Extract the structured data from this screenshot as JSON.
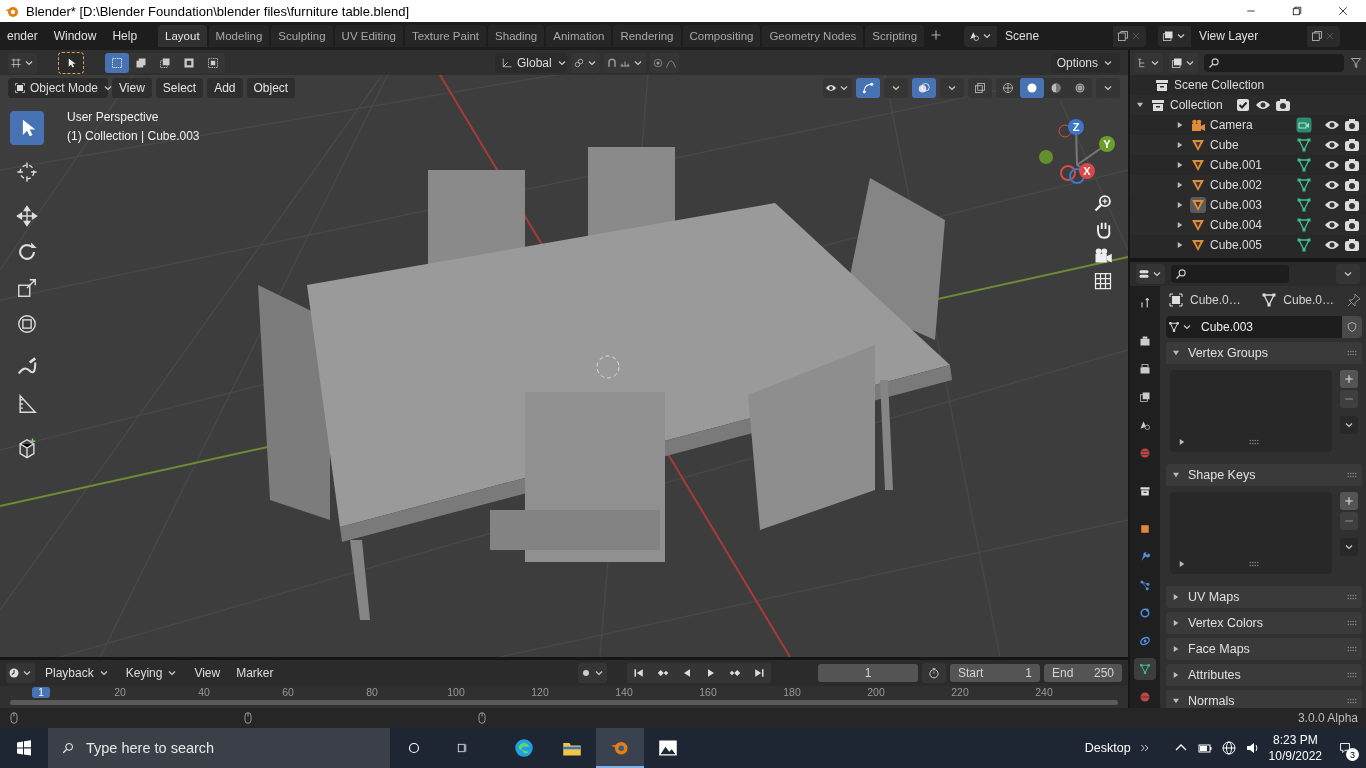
{
  "window": {
    "title": "Blender* [D:\\Blender Foundation\\blender files\\furniture table.blend]"
  },
  "menu": [
    "ender",
    "Window",
    "Help"
  ],
  "workspaces": [
    {
      "label": "Layout",
      "selected": true
    },
    {
      "label": "Modeling",
      "selected": false
    },
    {
      "label": "Sculpting",
      "selected": false
    },
    {
      "label": "UV Editing",
      "selected": false
    },
    {
      "label": "Texture Paint",
      "selected": false
    },
    {
      "label": "Shading",
      "selected": false
    },
    {
      "label": "Animation",
      "selected": false
    },
    {
      "label": "Rendering",
      "selected": false
    },
    {
      "label": "Compositing",
      "selected": false
    },
    {
      "label": "Geometry Nodes",
      "selected": false
    },
    {
      "label": "Scripting",
      "selected": false
    }
  ],
  "scene": "Scene",
  "view_layer": "View Layer",
  "tool_header": {
    "select_modes": [
      {
        "kind": "set",
        "selected": true
      },
      {
        "kind": "extend",
        "selected": false
      },
      {
        "kind": "subtract",
        "selected": false
      },
      {
        "kind": "difference",
        "selected": false
      },
      {
        "kind": "intersect",
        "selected": false
      }
    ],
    "orientation": "Global",
    "options": "Options"
  },
  "viewport_header": {
    "mode": "Object Mode",
    "menus": [
      "View",
      "Select",
      "Add",
      "Object"
    ],
    "gizmos_on": true,
    "overlays_on": true,
    "xray": false,
    "shading": [
      {
        "kind": "wireframe",
        "selected": false
      },
      {
        "kind": "solid",
        "selected": true
      },
      {
        "kind": "material",
        "selected": false
      },
      {
        "kind": "rendered",
        "selected": false
      }
    ]
  },
  "viewport": {
    "perspective": "User Perspective",
    "selection": "(1) Collection | Cube.003",
    "gizmo_axes": [
      "Z",
      "Y",
      "X"
    ],
    "tools": [
      {
        "kind": "select",
        "selected": true
      },
      {
        "kind": "cursor",
        "selected": false
      },
      {
        "kind": "move",
        "selected": false
      },
      {
        "kind": "rotate",
        "selected": false
      },
      {
        "kind": "scale",
        "selected": false
      },
      {
        "kind": "transform",
        "selected": false
      },
      {
        "kind": "annotate",
        "selected": false
      },
      {
        "kind": "measure",
        "selected": false
      },
      {
        "kind": "add_cube",
        "selected": false
      }
    ]
  },
  "outliner": {
    "root": "Scene Collection",
    "items": [
      {
        "name": "Collection",
        "kind": "collection",
        "checked": true,
        "expanded": true,
        "selected": false,
        "children": [
          {
            "name": "Camera",
            "kind": "camera",
            "expanded": false,
            "selected": false
          },
          {
            "name": "Cube",
            "kind": "mesh",
            "expanded": false,
            "selected": false
          },
          {
            "name": "Cube.001",
            "kind": "mesh",
            "expanded": false,
            "selected": false
          },
          {
            "name": "Cube.002",
            "kind": "mesh",
            "expanded": false,
            "selected": false
          },
          {
            "name": "Cube.003",
            "kind": "mesh",
            "expanded": false,
            "selected": true
          },
          {
            "name": "Cube.004",
            "kind": "mesh",
            "expanded": false,
            "selected": false
          },
          {
            "name": "Cube.005",
            "kind": "mesh",
            "expanded": false,
            "selected": false
          }
        ]
      }
    ]
  },
  "properties": {
    "breadcrumb": [
      "Cube.0…",
      "Cube.0…"
    ],
    "data_name": "Cube.003",
    "panels": [
      {
        "title": "Vertex Groups",
        "expanded": true
      },
      {
        "title": "Shape Keys",
        "expanded": true
      },
      {
        "title": "UV Maps",
        "expanded": false
      },
      {
        "title": "Vertex Colors",
        "expanded": false
      },
      {
        "title": "Face Maps",
        "expanded": false
      },
      {
        "title": "Attributes",
        "expanded": false
      },
      {
        "title": "Normals",
        "expanded": true
      }
    ]
  },
  "timeline": {
    "menus": [
      "Playback",
      "Keying",
      "View",
      "Marker"
    ],
    "current_frame": "1",
    "start_label": "Start",
    "start": "1",
    "end_label": "End",
    "end": "250",
    "ruler": [
      "1",
      "20",
      "40",
      "60",
      "80",
      "100",
      "120",
      "140",
      "160",
      "180",
      "200",
      "220",
      "240"
    ]
  },
  "status_bar": {
    "version": "3.0.0 Alpha"
  },
  "taskbar": {
    "search_placeholder": "Type here to search",
    "desktop": "Desktop",
    "time": "8:23 PM",
    "date": "10/9/2022",
    "notifications": "3"
  }
}
